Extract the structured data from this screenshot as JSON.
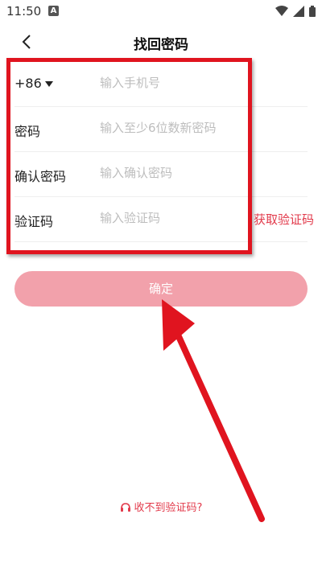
{
  "status_bar": {
    "time": "11:50",
    "notif_icon": "A"
  },
  "nav": {
    "title": "找回密码"
  },
  "form": {
    "phone": {
      "country_code": "+86",
      "placeholder": "输入手机号"
    },
    "password": {
      "label": "密码",
      "placeholder": "输入至少6位数新密码"
    },
    "confirm_password": {
      "label": "确认密码",
      "placeholder": "输入确认密码"
    },
    "code": {
      "label": "验证码",
      "placeholder": "输入验证码",
      "get_code_label": "获取验证码"
    }
  },
  "confirm_button": {
    "label": "确定"
  },
  "help": {
    "label": "收不到验证码?"
  },
  "colors": {
    "accent": "#e23a4b",
    "button_bg": "#f2a1ab",
    "highlight": "#e0141f"
  }
}
